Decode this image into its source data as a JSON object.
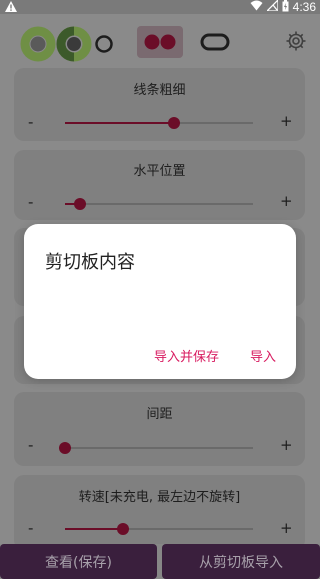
{
  "status_bar": {
    "time": "4:36",
    "icons": [
      "warning-icon",
      "wifi-icon",
      "no-signal-icon",
      "battery-icon"
    ]
  },
  "toolbar": {
    "icons": [
      "ring-style-icon",
      "split-ring-style-icon",
      "small-ring-icon",
      "dual-dots-icon",
      "pill-outline-icon",
      "gear-icon"
    ],
    "accent_color": "#6b0d28",
    "green_color": "#8bc34a"
  },
  "cards": [
    {
      "title": "线条粗细",
      "minus": "-",
      "plus": "+",
      "slider_fraction": 0.58
    },
    {
      "title": "水平位置",
      "minus": "-",
      "plus": "+",
      "slider_fraction": 0.08
    },
    {
      "title": "间距",
      "minus": "-",
      "plus": "+",
      "slider_fraction": 0.0
    },
    {
      "title": "转速[未充电, 最左边不旋转]",
      "minus": "-",
      "plus": "+",
      "slider_fraction": 0.31
    }
  ],
  "bottom": {
    "view_save_label": "查看(保存)",
    "import_clipboard_label": "从剪切板导入"
  },
  "dialog": {
    "title": "剪切板内容",
    "import_save_label": "导入并保存",
    "import_label": "导入",
    "action_color": "#d81b60"
  }
}
